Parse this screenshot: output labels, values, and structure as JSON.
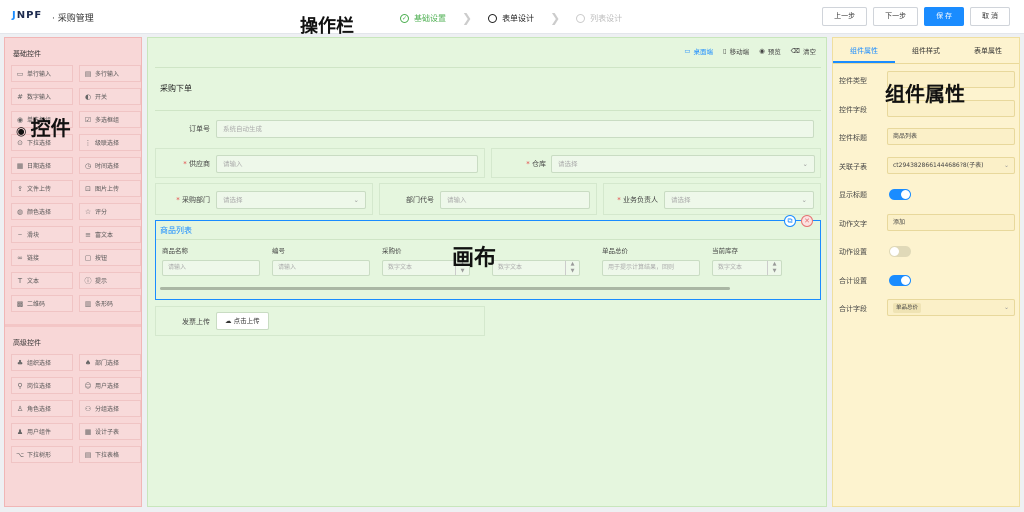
{
  "header": {
    "logo_j": "J",
    "logo_rest": "NPF",
    "title": "· 采购管理",
    "steps": [
      {
        "label": "基础设置",
        "state": "done",
        "icon": "check-circle"
      },
      {
        "label": "表单设计",
        "state": "active",
        "icon": "circle"
      },
      {
        "label": "列表设计",
        "state": "todo",
        "icon": "circle"
      }
    ],
    "buttons": {
      "prev": "上一步",
      "next": "下一步",
      "save": "保 存",
      "cancel": "取 消"
    }
  },
  "annotations": {
    "toolbar": "操作栏",
    "controls": "控件",
    "canvas": "画布",
    "props": "组件属性"
  },
  "left": {
    "basic_title": "基础控件",
    "basic_items": [
      {
        "label": "单行输入",
        "icon": "input-icon"
      },
      {
        "label": "多行输入",
        "icon": "textarea-icon"
      },
      {
        "label": "数字输入",
        "icon": "number-icon"
      },
      {
        "label": "开关",
        "icon": "switch-icon"
      },
      {
        "label": "单选框组",
        "icon": "radio-icon"
      },
      {
        "label": "多选框组",
        "icon": "checkbox-icon"
      },
      {
        "label": "下拉选择",
        "icon": "select-icon"
      },
      {
        "label": "级联选择",
        "icon": "cascader-icon"
      },
      {
        "label": "日期选择",
        "icon": "date-icon"
      },
      {
        "label": "时间选择",
        "icon": "time-icon"
      },
      {
        "label": "文件上传",
        "icon": "upload-icon"
      },
      {
        "label": "图片上传",
        "icon": "image-upload-icon"
      },
      {
        "label": "颜色选择",
        "icon": "color-icon"
      },
      {
        "label": "评分",
        "icon": "star-icon"
      },
      {
        "label": "滑块",
        "icon": "slider-icon"
      },
      {
        "label": "富文本",
        "icon": "richtext-icon"
      },
      {
        "label": "链接",
        "icon": "link-icon"
      },
      {
        "label": "按钮",
        "icon": "button-icon"
      },
      {
        "label": "文本",
        "icon": "text-icon"
      },
      {
        "label": "提示",
        "icon": "tip-icon"
      },
      {
        "label": "二维码",
        "icon": "qrcode-icon"
      },
      {
        "label": "条形码",
        "icon": "barcode-icon"
      }
    ],
    "adv_title": "高级控件",
    "adv_items": [
      {
        "label": "组织选择",
        "icon": "org-icon"
      },
      {
        "label": "部门选择",
        "icon": "dept-icon"
      },
      {
        "label": "岗位选择",
        "icon": "post-icon"
      },
      {
        "label": "用户选择",
        "icon": "user-icon"
      },
      {
        "label": "角色选择",
        "icon": "role-icon"
      },
      {
        "label": "分组选择",
        "icon": "group-icon"
      },
      {
        "label": "用户组件",
        "icon": "user-comp-icon"
      },
      {
        "label": "设计子表",
        "icon": "table-icon"
      },
      {
        "label": "下拉树形",
        "icon": "tree-icon"
      },
      {
        "label": "下拉表格",
        "icon": "table-select-icon"
      }
    ]
  },
  "canvas": {
    "toolbar": {
      "desktop": "桌面端",
      "mobile": "移动端",
      "preview": "预览",
      "clear": "清空"
    },
    "form_title": "采购下单",
    "order_no": {
      "label": "订单号",
      "placeholder": "系统自动生成"
    },
    "supplier": {
      "label": "供应商",
      "placeholder": "请输入"
    },
    "warehouse": {
      "label": "仓库",
      "placeholder": "请选择"
    },
    "dept": {
      "label": "采购部门",
      "placeholder": "请选择"
    },
    "dept_code": {
      "label": "部门代号",
      "placeholder": "请输入"
    },
    "manager": {
      "label": "业务负责人",
      "placeholder": "请选择"
    },
    "table": {
      "title": "商品列表",
      "columns": [
        {
          "header": "商品名称",
          "placeholder": "请输入"
        },
        {
          "header": "编号",
          "placeholder": "请输入"
        },
        {
          "header": "采购价",
          "placeholder": "数字文本"
        },
        {
          "header": "",
          "placeholder": "数字文本"
        },
        {
          "header": "单品总价",
          "placeholder": "用于提示计算结果，回则"
        },
        {
          "header": "当前库存",
          "placeholder": "数字文本"
        }
      ]
    },
    "upload": {
      "label": "发票上传",
      "button": "点击上传"
    }
  },
  "right": {
    "tabs": [
      "组件属性",
      "组件样式",
      "表单属性"
    ],
    "props": [
      {
        "label": "控件类型",
        "value": "",
        "type": "input"
      },
      {
        "label": "控件字段",
        "value": "",
        "type": "input"
      },
      {
        "label": "控件标题",
        "value": "商品列表",
        "type": "input"
      },
      {
        "label": "关联子表",
        "value": "ct2943828661444686?8(子表)",
        "type": "select"
      },
      {
        "label": "显示标题",
        "value": "on",
        "type": "toggle"
      },
      {
        "label": "动作文字",
        "value": "添加",
        "type": "input"
      },
      {
        "label": "动作设置",
        "value": "off",
        "type": "toggle"
      },
      {
        "label": "合计设置",
        "value": "on",
        "type": "toggle"
      },
      {
        "label": "合计字段",
        "value": "单品总价",
        "type": "chip"
      }
    ]
  }
}
